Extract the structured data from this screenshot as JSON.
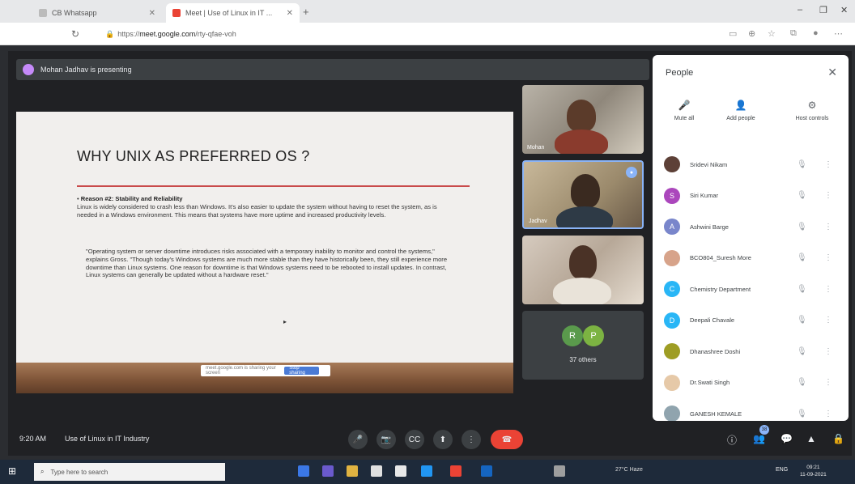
{
  "browser": {
    "tabs": [
      {
        "title": "CB Whatsapp",
        "active": false,
        "favicon_color": "#bbbbbb"
      },
      {
        "title": "Meet | Use of Linux in IT ...",
        "active": true,
        "favicon_color": "#ea4335"
      }
    ],
    "new_tab": "+",
    "url_prefix": "https://",
    "url_host": "meet.google.com",
    "url_path": "/rty-qfae-voh",
    "window_controls": [
      "–",
      "❐",
      "✕"
    ]
  },
  "meet": {
    "presenting_text": "Mohan Jadhav is presenting",
    "slide": {
      "title": "WHY UNIX AS PREFERRED OS ?",
      "bullet_heading": "Reason #2: Stability and Reliability",
      "bullet_text": "Linux is widely considered to crash less than Windows. It's also easier to update the system without having to reset the system, as is needed in a Windows environment. This means that systems have more uptime and increased productivity levels.",
      "quote": "\"Operating system or server downtime introduces risks associated with a temporary inability to monitor and control the systems,\" explains Gross. \"Though today's Windows systems are much more stable than they have historically been, they still experience more downtime than Linux systems. One reason for downtime is that Windows systems need to be rebooted to install updates. In contrast, Linux systems can generally be updated without a hardware reset.\"",
      "cursor": "▸",
      "share_bar_text": "meet.google.com is sharing your screen",
      "share_bar_button": "Stop sharing"
    },
    "tiles": [
      {
        "name": "Mohan",
        "badge": ""
      },
      {
        "name": "Jadhav",
        "badge": "●"
      },
      {
        "name": "",
        "badge": ""
      }
    ],
    "others": {
      "avatars": [
        {
          "letter": "R",
          "color": "#5a9a4c"
        },
        {
          "letter": "P",
          "color": "#7cb342"
        }
      ],
      "label": "37 others"
    },
    "people_panel": {
      "title": "People",
      "close": "✕",
      "actions": [
        {
          "icon": "🎤",
          "label": "Mute all"
        },
        {
          "icon": "👤",
          "label": "Add people"
        },
        {
          "icon": "⚙",
          "label": "Host controls"
        }
      ],
      "participants": [
        {
          "name": "Sridevi Nikam",
          "initial": "",
          "color": "#5d4037"
        },
        {
          "name": "Siri Kumar",
          "initial": "S",
          "color": "#ab47bc"
        },
        {
          "name": "Ashwini Barge",
          "initial": "A",
          "color": "#7986cb"
        },
        {
          "name": "BCO804_Suresh More",
          "initial": "",
          "color": "#d7a38a"
        },
        {
          "name": "Chemistry Department",
          "initial": "C",
          "color": "#29b6f6"
        },
        {
          "name": "Deepali Chavale",
          "initial": "D",
          "color": "#29b6f6"
        },
        {
          "name": "Dhanashree Doshi",
          "initial": "",
          "color": "#9e9d24"
        },
        {
          "name": "Dr.Swati Singh",
          "initial": "",
          "color": "#e6c9a8"
        },
        {
          "name": "GANESH KEMALE",
          "initial": "",
          "color": "#90a4ae"
        }
      ],
      "mic_icon": "🎙",
      "more_icon": "⋮"
    },
    "bottom": {
      "time": "9:20 AM",
      "meeting_title": "Use of Linux in IT Industry",
      "controls": [
        "🎤",
        "📷",
        "CC",
        "⬆",
        "⋮"
      ],
      "end_call_icon": "☎",
      "right_icons": [
        "ⓘ",
        "👥",
        "💬",
        "▲",
        "🔒"
      ],
      "people_count": "38"
    }
  },
  "taskbar": {
    "start_icon": "⊞",
    "search_placeholder": "Type here to search",
    "search_icon": "⌕",
    "weather": "27°C Haze",
    "language": "ENG",
    "time": "09:21",
    "date": "11-09-2021",
    "app_colors": [
      "#3b78e7",
      "#6a5acd",
      "#e0b341",
      "#e0e0e0",
      "#e8e8e8",
      "#2196f3",
      "#ea4335",
      "#1565c0",
      "#9e9e9e"
    ]
  }
}
